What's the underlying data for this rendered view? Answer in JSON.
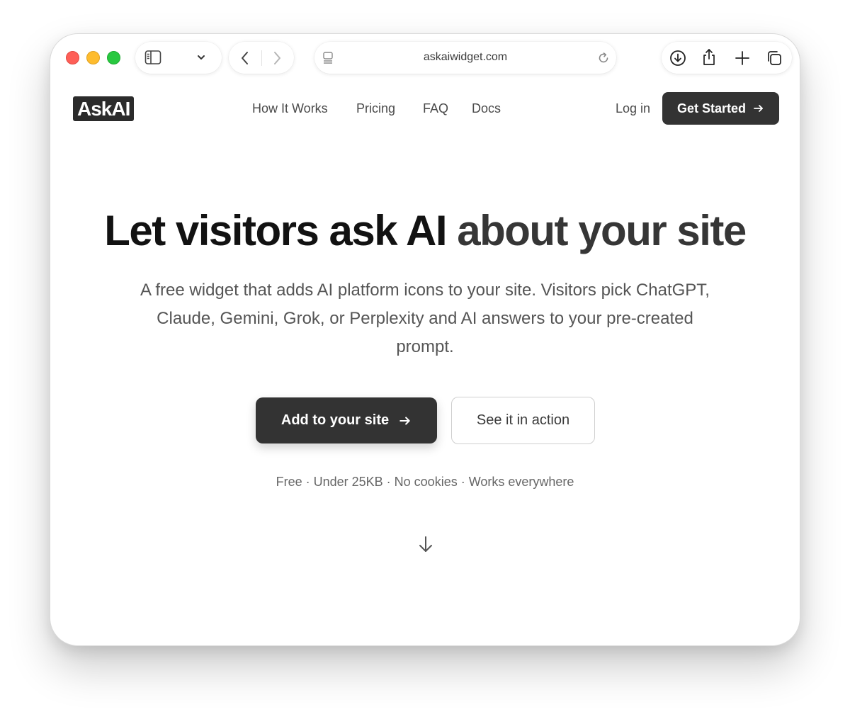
{
  "browser": {
    "url": "askaiwidget.com",
    "traffic_lights": {
      "close": "#fe5f57",
      "minimize": "#febc2e",
      "zoom": "#28c840"
    },
    "icons": [
      "sidebar-icon",
      "chevron-down-icon",
      "back-icon",
      "forward-icon",
      "page-icon",
      "reload-icon",
      "download-icon",
      "share-icon",
      "new-tab-icon",
      "tabs-overview-icon"
    ]
  },
  "header": {
    "logo": "AskAI",
    "nav": [
      "How It Works",
      "Pricing",
      "FAQ",
      "Docs"
    ],
    "login": "Log in",
    "cta": "Get Started"
  },
  "hero": {
    "title_main": "Let visitors ask AI ",
    "title_accent": "about your site",
    "subtitle": "A free widget that adds AI platform icons to your site. Visitors pick ChatGPT, Claude, Gemini, Grok, or Perplexity and AI answers to your pre-created prompt.",
    "primary_button": "Add to your site",
    "secondary_button": "See it in action",
    "features": "Free · Under 25KB · No cookies · Works everywhere"
  },
  "colors": {
    "dark_button": "#333333",
    "title": "#121212",
    "body_text": "#555555"
  }
}
